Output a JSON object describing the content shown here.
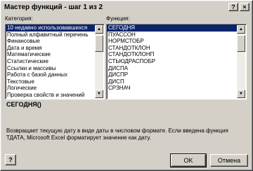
{
  "window": {
    "title": "Мастер функций - шаг 1 из 2",
    "help_button": "?",
    "close_button": "×"
  },
  "category": {
    "label": "Категория:",
    "items": [
      "10 недавно использовавшихся",
      "Полный алфавитный перечень",
      "Финансовые",
      "Дата и время",
      "Математические",
      "Статистические",
      "Ссылки и массивы",
      "Работа с базой данных",
      "Текстовые",
      "Логические",
      "Проверка свойств и значений"
    ],
    "selected_index": 0
  },
  "function": {
    "label": "Функция:",
    "items": [
      "СЕГОДНЯ",
      "ПУАССОН",
      "НОРМСТОБР",
      "СТАНДОТКЛОН",
      "СТАНДОТКЛОНП",
      "СТЬЮДРАСПОБР",
      "ДИСПА",
      "ДИСПР",
      "ДИСП",
      "СРЗНАЧ"
    ],
    "selected_index": 0
  },
  "selected_function": {
    "signature": "СЕГОДНЯ()",
    "description": "Возвращает текущую дату в виде даты в числовом формате. Если введена функция ТДАТА, Microsoft Excel форматирует значение как дату."
  },
  "buttons": {
    "ok": "OK",
    "cancel": "Отмена",
    "help_icon": "?"
  },
  "scroll_icons": {
    "up": "▲",
    "down": "▼"
  }
}
